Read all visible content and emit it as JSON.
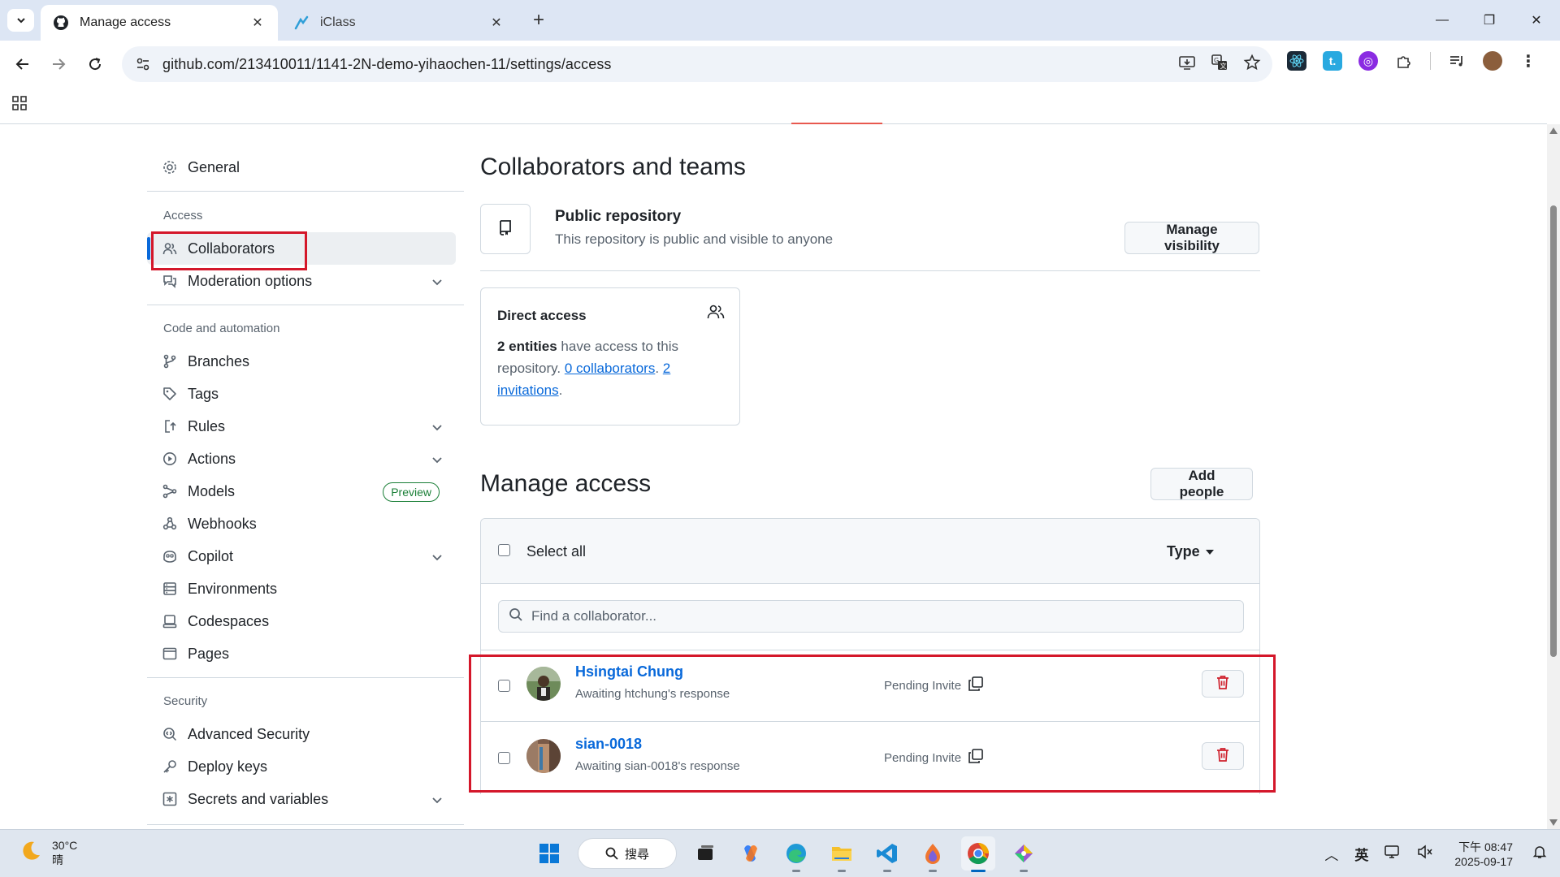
{
  "browser": {
    "tabs": [
      {
        "title": "Manage access",
        "active": true
      },
      {
        "title": "iClass",
        "active": false
      }
    ],
    "url": "github.com/213410011/1141-2N-demo-yihaochen-11/settings/access"
  },
  "sidebar": {
    "general": "General",
    "access_heading": "Access",
    "collaborators": "Collaborators",
    "moderation": "Moderation options",
    "code_heading": "Code and automation",
    "branches": "Branches",
    "tags": "Tags",
    "rules": "Rules",
    "actions": "Actions",
    "models": "Models",
    "models_badge": "Preview",
    "webhooks": "Webhooks",
    "copilot": "Copilot",
    "environments": "Environments",
    "codespaces": "Codespaces",
    "pages": "Pages",
    "security_heading": "Security",
    "advanced_security": "Advanced Security",
    "deploy_keys": "Deploy keys",
    "secrets": "Secrets and variables"
  },
  "main": {
    "title": "Collaborators and teams",
    "repo_visibility_title": "Public repository",
    "repo_visibility_desc": "This repository is public and visible to anyone",
    "manage_visibility_button": "Manage visibility",
    "direct_access": {
      "title": "Direct access",
      "count_bold": "2 entities",
      "text_1": " have access to this repository. ",
      "link_collaborators": "0 collaborators",
      "text_2": ". ",
      "link_invitations": "2 invitations",
      "text_3": "."
    },
    "manage_access_title": "Manage access",
    "add_people_button": "Add people",
    "select_all": "Select all",
    "type_filter": "Type",
    "search_placeholder": "Find a collaborator...",
    "collaborators": [
      {
        "name": "Hsingtai Chung",
        "sub": "Awaiting htchung's response",
        "status": "Pending Invite"
      },
      {
        "name": "sian-0018",
        "sub": "Awaiting sian-0018's response",
        "status": "Pending Invite"
      }
    ]
  },
  "taskbar": {
    "weather_temp": "30°C",
    "weather_desc": "晴",
    "search_label": "搜尋",
    "ime": "英",
    "time": "下午 08:47",
    "date": "2025-09-17"
  },
  "colors": {
    "link": "#0969da",
    "highlight_box": "#d4172a",
    "selected_bar": "#0969da",
    "delete_icon": "#cf222e",
    "preview_badge": "#1a7f37"
  }
}
